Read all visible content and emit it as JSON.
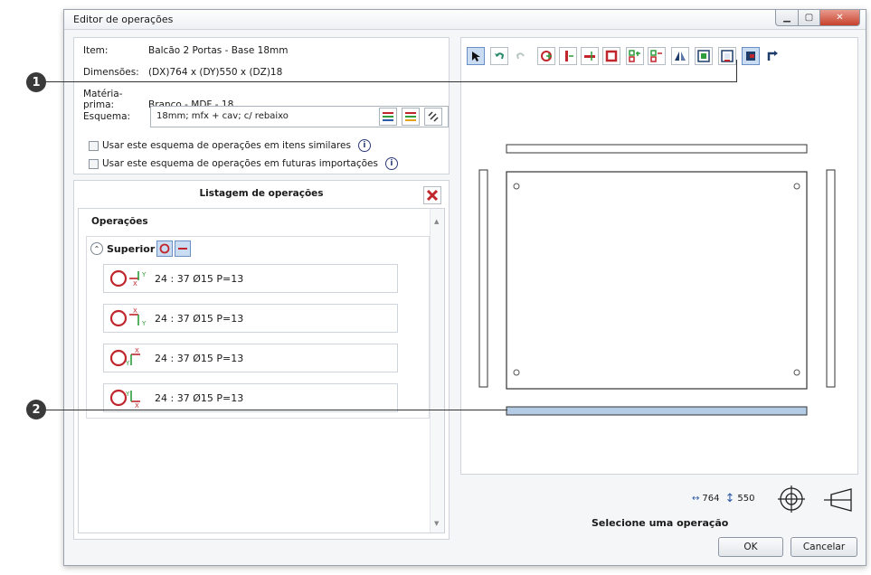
{
  "window": {
    "title": "Editor de operações"
  },
  "info": {
    "item_label": "Item:",
    "item_value": "Balcão 2 Portas - Base 18mm",
    "dim_label": "Dimensões:",
    "dim_value": "(DX)764 x (DY)550 x (DZ)18",
    "mat_label": "Matéria-prima:",
    "mat_value": "Branco - MDF - 18",
    "schema_label": "Esquema:",
    "schema_value": "18mm; mfx + cav; c/ rebaixo"
  },
  "checkboxes": [
    {
      "label": "Usar este esquema de operações em itens similares"
    },
    {
      "label": "Usar este esquema de operações em futuras importações"
    }
  ],
  "list": {
    "title": "Listagem de operações",
    "section": "Operações",
    "group": "Superior",
    "items": [
      {
        "text": "24 : 37 Ø15 P=13"
      },
      {
        "text": "24 : 37 Ø15 P=13"
      },
      {
        "text": "24 : 37 Ø15 P=13"
      },
      {
        "text": "24 : 37 Ø15 P=13"
      }
    ]
  },
  "preview": {
    "dx": "764",
    "dy": "550",
    "status": "Selecione uma operação"
  },
  "buttons": {
    "ok": "OK",
    "cancel": "Cancelar"
  },
  "callouts": [
    "1",
    "2"
  ],
  "colors": {
    "accent": "#c0262c",
    "select": "#b4cbe6",
    "green": "#2e9d3a"
  }
}
